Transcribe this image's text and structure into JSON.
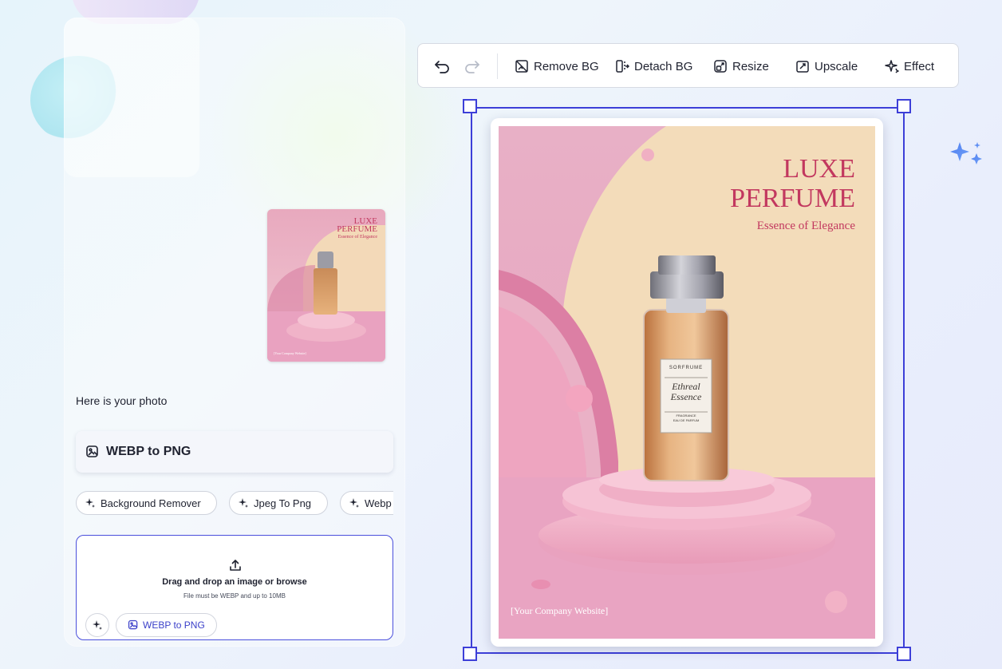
{
  "chat": {
    "caption": "Here is your photo",
    "thumbnail": {
      "title_line1": "LUXE",
      "title_line2": "PERFUME",
      "subtitle": "Essence of Elegance",
      "footer": "[Your Company Website]"
    }
  },
  "tool_card": {
    "label": "WEBP to PNG",
    "icon": "image-convert-icon"
  },
  "suggestions": [
    {
      "label": "Background Remover",
      "icon": "sparkle-icon"
    },
    {
      "label": "Jpeg To Png",
      "icon": "sparkle-icon"
    },
    {
      "label": "Webp",
      "icon": "sparkle-icon"
    }
  ],
  "upload": {
    "icon": "upload-icon",
    "title": "Drag and drop an image or browse",
    "note": "File must be WEBP and up to 10MB",
    "tool_chip": "WEBP to PNG"
  },
  "toolbar": {
    "undo_icon": "undo-icon",
    "redo_icon": "redo-icon",
    "remove_bg": "Remove BG",
    "detach_bg": "Detach BG",
    "resize": "Resize",
    "upscale": "Upscale",
    "effect": "Effect"
  },
  "poster": {
    "title_line1": "LUXE",
    "title_line2": "PERFUME",
    "subtitle": "Essence of Elegance",
    "brand": "SORFRUME",
    "product_line1": "Ethreal",
    "product_line2": "Essence",
    "product_small1": "FRAGRANCE",
    "product_small2": "EAU DE PARFUM",
    "footer": "[Your Company Website]"
  },
  "colors": {
    "accent": "#3d3fd8",
    "poster_title": "#c2385f",
    "poster_bg": "#e8a8bf"
  }
}
